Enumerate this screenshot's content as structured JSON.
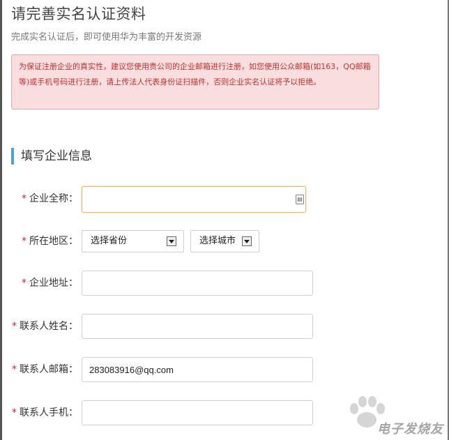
{
  "page": {
    "title": "请完善实名认证资料",
    "subtitle": "完成实名认证后，即可使用华为丰富的开发资源"
  },
  "alert": {
    "text": "为保证注册企业的真实性，建议您使用贵公司的企业邮箱进行注册，如您使用公众邮箱(如163，QQ邮箱等)或手机号码进行注册，请上传法人代表身份证扫描件，否则企业实名认证将予以拒绝。"
  },
  "section": {
    "title": "填写企业信息"
  },
  "form": {
    "required_mark": "*",
    "company_name": {
      "label": "企业全称：",
      "value": ""
    },
    "region": {
      "label": "所在地区：",
      "province_select": "选择省份",
      "city_select": "选择城市"
    },
    "company_address": {
      "label": "企业地址：",
      "value": ""
    },
    "contact_name": {
      "label": "联系人姓名：",
      "value": ""
    },
    "contact_email": {
      "label": "联系人邮箱：",
      "value": "283083916@qq.com"
    },
    "contact_phone": {
      "label": "联系人手机：",
      "value": ""
    }
  },
  "watermark": {
    "text": "电子发烧友"
  },
  "colors": {
    "accent_bar": "#4aa6d8",
    "alert_bg": "#f8dede",
    "alert_text": "#c0302f",
    "required": "#dd2233",
    "focus_border": "#e3b86b"
  },
  "icons": {
    "contact_card": "contact-card-icon",
    "dropdown": "chevron-down-icon"
  }
}
